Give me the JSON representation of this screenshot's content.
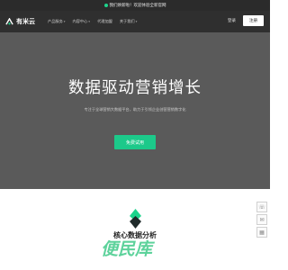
{
  "announcement": {
    "text": "我们焕新啦！欢迎体验全新官网"
  },
  "brand": {
    "name": "有米云",
    "accent": "#1dd48c"
  },
  "nav": {
    "items": [
      {
        "label": "产品服务",
        "has_dropdown": true
      },
      {
        "label": "内容中心",
        "has_dropdown": true
      },
      {
        "label": "代理加盟",
        "has_dropdown": false
      },
      {
        "label": "关于我们",
        "has_dropdown": true
      }
    ],
    "login": "登录",
    "signup": "注册"
  },
  "hero": {
    "title": "数据驱动营销增长",
    "subtitle": "专注于全球营销大数据平台，助力于引领企业创营营销数字化",
    "cta": "免费试用",
    "background": "#5a5a5a"
  },
  "section": {
    "heading": "核心数据分析"
  },
  "side_tools": [
    {
      "icon": "phone-icon"
    },
    {
      "icon": "chat-icon"
    },
    {
      "icon": "qrcode-icon"
    }
  ],
  "watermark": {
    "text": "便民库"
  }
}
